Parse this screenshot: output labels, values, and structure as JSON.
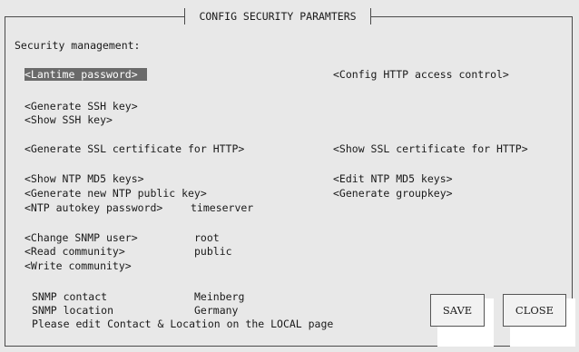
{
  "dialog": {
    "title": "CONFIG SECURITY PARAMTERS",
    "section_heading": "Security management:"
  },
  "menu": {
    "lantime_password": "<Lantime password>",
    "config_http_access": "<Config HTTP access control>",
    "generate_ssh_key": "<Generate SSH key>",
    "show_ssh_key": "<Show SSH key>",
    "generate_ssl_cert": "<Generate SSL certificate for HTTP>",
    "show_ssl_cert": "<Show SSL certificate for HTTP>",
    "show_ntp_md5_keys": "<Show NTP MD5 keys>",
    "edit_ntp_md5_keys": "<Edit NTP MD5 keys>",
    "generate_ntp_public_key": "<Generate new NTP public key>",
    "generate_groupkey": "<Generate groupkey>",
    "ntp_autokey_password": "<NTP autokey password>",
    "change_snmp_user": "<Change SNMP user>",
    "read_community": "<Read community>",
    "write_community": "<Write community>"
  },
  "values": {
    "ntp_autokey_password": "timeserver",
    "snmp_user": "root",
    "read_community": "public"
  },
  "snmp_info": {
    "contact_label": "SNMP contact",
    "contact_value": "Meinberg",
    "location_label": "SNMP location",
    "location_value": "Germany",
    "note": "Please edit Contact & Location on the LOCAL page"
  },
  "buttons": {
    "save": "SAVE",
    "close": "CLOSE"
  },
  "colors": {
    "background": "#e8e8e8",
    "selection": "#6a6a6a",
    "frame": "#4a4a4a"
  }
}
